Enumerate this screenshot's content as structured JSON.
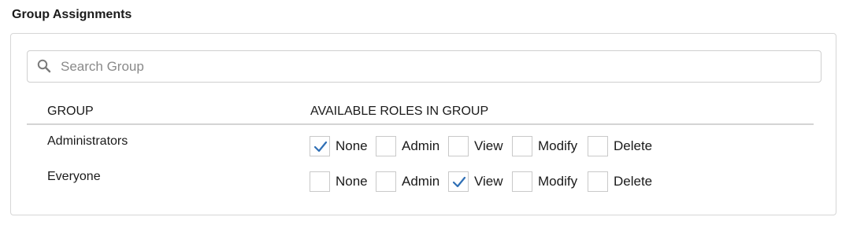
{
  "title": "Group Assignments",
  "search": {
    "placeholder": "Search Group",
    "value": ""
  },
  "columns": {
    "group": "GROUP",
    "roles": "AVAILABLE ROLES IN GROUP"
  },
  "role_labels": [
    "None",
    "Admin",
    "View",
    "Modify",
    "Delete"
  ],
  "rows": [
    {
      "group": "Administrators",
      "selected_role": "None"
    },
    {
      "group": "Everyone",
      "selected_role": "View"
    }
  ],
  "colors": {
    "check": "#2f6fb5",
    "border": "#c9c9c9"
  },
  "icons": {
    "search": "search-icon",
    "check": "checkmark-icon"
  }
}
